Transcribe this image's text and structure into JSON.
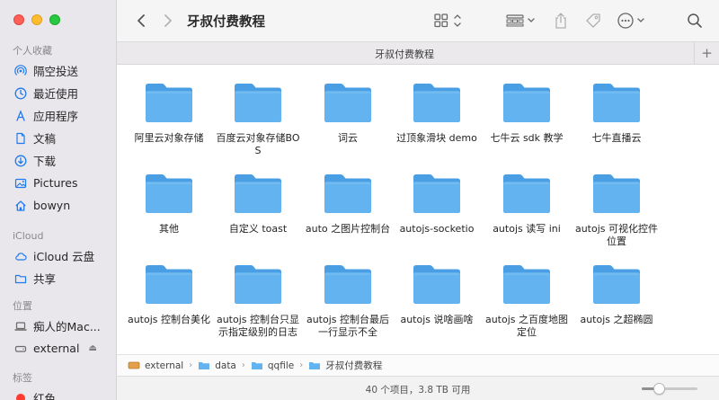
{
  "sidebar": {
    "favorites_heading": "个人收藏",
    "favorites": [
      {
        "label": "隔空投送",
        "icon": "airdrop-icon"
      },
      {
        "label": "最近使用",
        "icon": "clock-icon"
      },
      {
        "label": "应用程序",
        "icon": "applications-icon"
      },
      {
        "label": "文稿",
        "icon": "document-icon"
      },
      {
        "label": "下载",
        "icon": "download-icon"
      },
      {
        "label": "Pictures",
        "icon": "pictures-icon"
      },
      {
        "label": "bowyn",
        "icon": "home-icon"
      }
    ],
    "icloud_heading": "iCloud",
    "icloud": [
      {
        "label": "iCloud 云盘",
        "icon": "cloud-icon"
      },
      {
        "label": "共享",
        "icon": "shared-folder-icon"
      }
    ],
    "locations_heading": "位置",
    "locations": [
      {
        "label": "痴人的Mac...",
        "icon": "laptop-icon"
      },
      {
        "label": "external",
        "icon": "drive-icon",
        "eject": "⏏"
      }
    ],
    "tags_heading": "标签",
    "tags": [
      {
        "label": "红色",
        "color": "#ff3b30"
      }
    ]
  },
  "toolbar": {
    "title": "牙叔付费教程"
  },
  "tab": {
    "label": "牙叔付费教程",
    "add": "+"
  },
  "files": [
    {
      "name": "阿里云对象存储"
    },
    {
      "name": "百度云对象存储BOS"
    },
    {
      "name": "词云"
    },
    {
      "name": "过顶象滑块 demo"
    },
    {
      "name": "七牛云 sdk 教学"
    },
    {
      "name": "七牛直播云"
    },
    {
      "name": "其他"
    },
    {
      "name": "自定义 toast"
    },
    {
      "name": "auto 之图片控制台"
    },
    {
      "name": "autojs-socketio"
    },
    {
      "name": "autojs 读写 ini"
    },
    {
      "name": "autojs 可视化控件位置"
    },
    {
      "name": "autojs 控制台美化"
    },
    {
      "name": "autojs 控制台只显示指定级别的日志"
    },
    {
      "name": "autojs 控制台最后一行显示不全"
    },
    {
      "name": "autojs 说啥画啥"
    },
    {
      "name": "autojs 之百度地图定位"
    },
    {
      "name": "autojs 之超椭圆"
    }
  ],
  "pathbar": {
    "crumbs": [
      "external",
      "data",
      "qqfile",
      "牙叔付费教程"
    ]
  },
  "status": {
    "text": "40 个项目，3.8 TB 可用",
    "zoom_fraction": 0.32
  },
  "colors": {
    "folder_body": "#62b3ef",
    "folder_back": "#4a9ee3",
    "accent": "#1f7aec"
  }
}
